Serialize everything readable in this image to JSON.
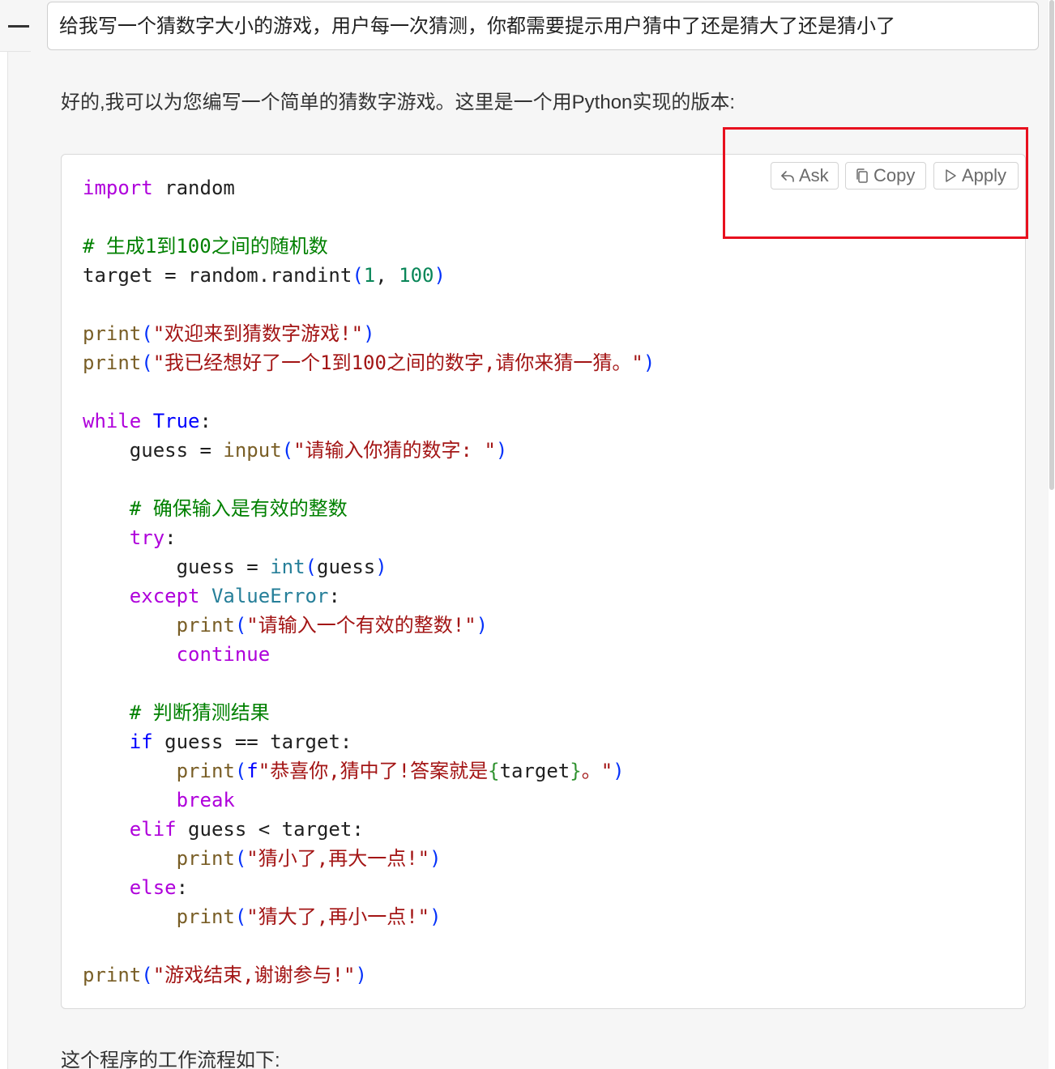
{
  "chat": {
    "user_message": "给我写一个猜数字大小的游戏，用户每一次猜测，你都需要提示用户猜中了还是猜大了还是猜小了",
    "reply_intro": "好的,我可以为您编写一个简单的猜数字游戏。这里是一个用Python实现的版本:",
    "reply_outro": "这个程序的工作流程如下:"
  },
  "code_actions": {
    "ask_label": "Ask",
    "copy_label": "Copy",
    "apply_label": "Apply",
    "ask_icon": "reply-arrow-icon",
    "copy_icon": "copy-icon",
    "apply_icon": "play-icon",
    "highlight_color": "#e8101e"
  },
  "code": {
    "language": "python",
    "lines": [
      [
        {
          "t": "import",
          "c": "kw"
        },
        {
          "t": " random",
          "c": "plain"
        }
      ],
      [],
      [
        {
          "t": "# 生成1到100之间的随机数",
          "c": "cm"
        }
      ],
      [
        {
          "t": "target = random.randint",
          "c": "plain"
        },
        {
          "t": "(",
          "c": "pb"
        },
        {
          "t": "1",
          "c": "num"
        },
        {
          "t": ", ",
          "c": "plain"
        },
        {
          "t": "100",
          "c": "num"
        },
        {
          "t": ")",
          "c": "pb"
        }
      ],
      [],
      [
        {
          "t": "print",
          "c": "fn"
        },
        {
          "t": "(",
          "c": "pb"
        },
        {
          "t": "\"欢迎来到猜数字游戏!\"",
          "c": "str"
        },
        {
          "t": ")",
          "c": "pb"
        }
      ],
      [
        {
          "t": "print",
          "c": "fn"
        },
        {
          "t": "(",
          "c": "pb"
        },
        {
          "t": "\"我已经想好了一个1到100之间的数字,请你来猜一猜。\"",
          "c": "str"
        },
        {
          "t": ")",
          "c": "pb"
        }
      ],
      [],
      [
        {
          "t": "while",
          "c": "kw"
        },
        {
          "t": " ",
          "c": "plain"
        },
        {
          "t": "True",
          "c": "kw2"
        },
        {
          "t": ":",
          "c": "plain"
        }
      ],
      [
        {
          "t": "    guess = ",
          "c": "plain"
        },
        {
          "t": "input",
          "c": "fn"
        },
        {
          "t": "(",
          "c": "pb"
        },
        {
          "t": "\"请输入你猜的数字: \"",
          "c": "str"
        },
        {
          "t": ")",
          "c": "pb"
        }
      ],
      [],
      [
        {
          "t": "    ",
          "c": "plain"
        },
        {
          "t": "# 确保输入是有效的整数",
          "c": "cm"
        }
      ],
      [
        {
          "t": "    ",
          "c": "plain"
        },
        {
          "t": "try",
          "c": "kw"
        },
        {
          "t": ":",
          "c": "plain"
        }
      ],
      [
        {
          "t": "        guess = ",
          "c": "plain"
        },
        {
          "t": "int",
          "c": "cls"
        },
        {
          "t": "(",
          "c": "pb"
        },
        {
          "t": "guess",
          "c": "plain"
        },
        {
          "t": ")",
          "c": "pb"
        }
      ],
      [
        {
          "t": "    ",
          "c": "plain"
        },
        {
          "t": "except",
          "c": "kw"
        },
        {
          "t": " ",
          "c": "plain"
        },
        {
          "t": "ValueError",
          "c": "cls"
        },
        {
          "t": ":",
          "c": "plain"
        }
      ],
      [
        {
          "t": "        ",
          "c": "plain"
        },
        {
          "t": "print",
          "c": "fn"
        },
        {
          "t": "(",
          "c": "pb"
        },
        {
          "t": "\"请输入一个有效的整数!\"",
          "c": "str"
        },
        {
          "t": ")",
          "c": "pb"
        }
      ],
      [
        {
          "t": "        ",
          "c": "plain"
        },
        {
          "t": "continue",
          "c": "kw"
        }
      ],
      [],
      [
        {
          "t": "    ",
          "c": "plain"
        },
        {
          "t": "# 判断猜测结果",
          "c": "cm"
        }
      ],
      [
        {
          "t": "    ",
          "c": "plain"
        },
        {
          "t": "if",
          "c": "kw2"
        },
        {
          "t": " guess == target:",
          "c": "plain"
        }
      ],
      [
        {
          "t": "        ",
          "c": "plain"
        },
        {
          "t": "print",
          "c": "fn"
        },
        {
          "t": "(",
          "c": "pb"
        },
        {
          "t": "f",
          "c": "kw2"
        },
        {
          "t": "\"恭喜你,猜中了!答案就是",
          "c": "str"
        },
        {
          "t": "{",
          "c": "pg"
        },
        {
          "t": "target",
          "c": "plain"
        },
        {
          "t": "}",
          "c": "pg"
        },
        {
          "t": "。\"",
          "c": "str"
        },
        {
          "t": ")",
          "c": "pb"
        }
      ],
      [
        {
          "t": "        ",
          "c": "plain"
        },
        {
          "t": "break",
          "c": "kw"
        }
      ],
      [
        {
          "t": "    ",
          "c": "plain"
        },
        {
          "t": "elif",
          "c": "kw"
        },
        {
          "t": " guess < target:",
          "c": "plain"
        }
      ],
      [
        {
          "t": "        ",
          "c": "plain"
        },
        {
          "t": "print",
          "c": "fn"
        },
        {
          "t": "(",
          "c": "pb"
        },
        {
          "t": "\"猜小了,再大一点!\"",
          "c": "str"
        },
        {
          "t": ")",
          "c": "pb"
        }
      ],
      [
        {
          "t": "    ",
          "c": "plain"
        },
        {
          "t": "else",
          "c": "kw"
        },
        {
          "t": ":",
          "c": "plain"
        }
      ],
      [
        {
          "t": "        ",
          "c": "plain"
        },
        {
          "t": "print",
          "c": "fn"
        },
        {
          "t": "(",
          "c": "pb"
        },
        {
          "t": "\"猜大了,再小一点!\"",
          "c": "str"
        },
        {
          "t": ")",
          "c": "pb"
        }
      ],
      [],
      [
        {
          "t": "print",
          "c": "fn"
        },
        {
          "t": "(",
          "c": "pb"
        },
        {
          "t": "\"游戏结束,谢谢参与!\"",
          "c": "str"
        },
        {
          "t": ")",
          "c": "pb"
        }
      ]
    ]
  }
}
